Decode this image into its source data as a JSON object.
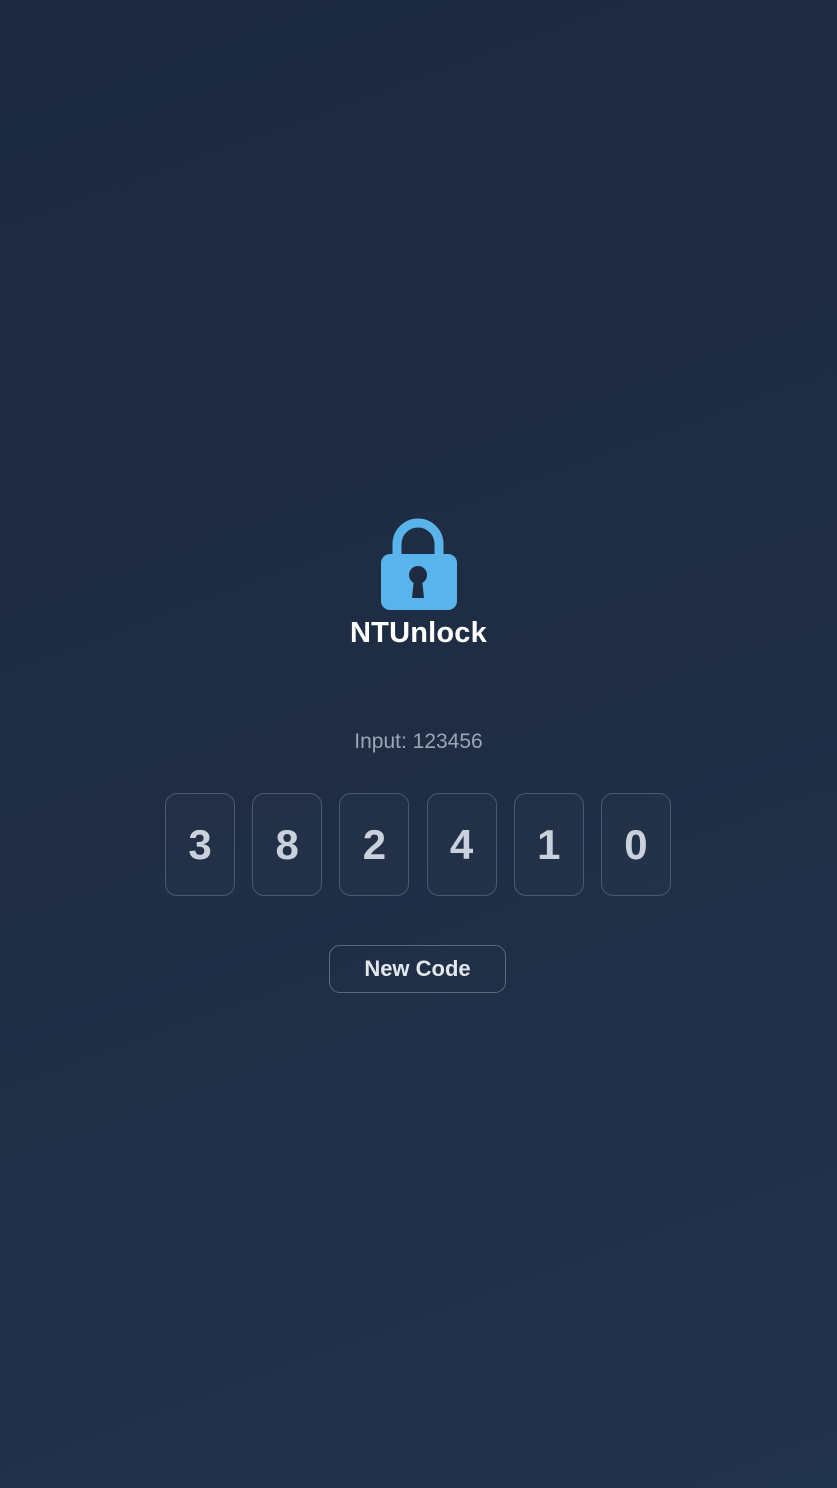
{
  "app": {
    "title": "NTUnlock",
    "icon": "lock-icon",
    "accent_color": "#5ab4ec"
  },
  "input": {
    "label": "Input: 123456"
  },
  "code": {
    "digits": [
      "3",
      "8",
      "2",
      "4",
      "1",
      "0"
    ]
  },
  "actions": {
    "new_code_label": "New Code"
  }
}
